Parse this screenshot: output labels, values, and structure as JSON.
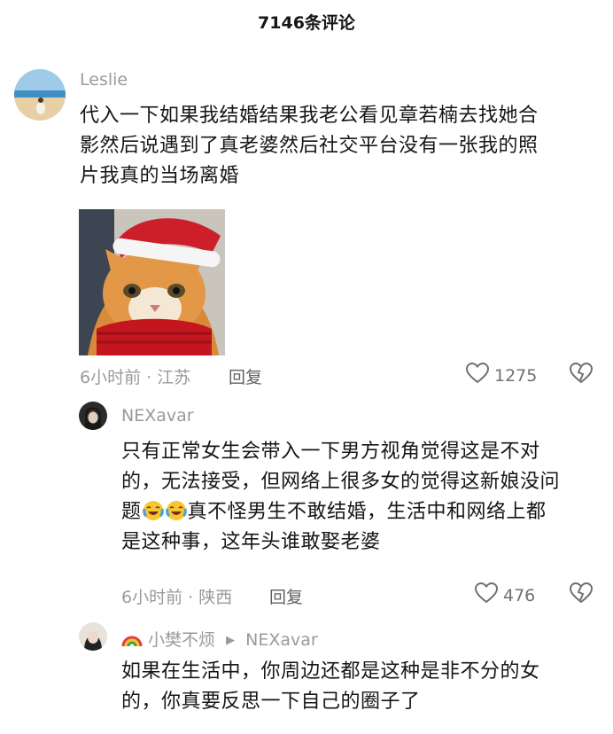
{
  "header": {
    "title": "7146条评论"
  },
  "comments": [
    {
      "username": "Leslie",
      "lines": [
        "代入一下如果我结婚结果我老公看见章若楠去找她合",
        "影然后说遇到了真老婆然后社交平台没有一张我的照",
        "片我真的当场离婚"
      ],
      "image_icon": "cat-santa-hat-image",
      "meta": "6小时前 · 江苏",
      "reply_label": "回复",
      "likes": "1275"
    },
    {
      "username": "NEXavar",
      "lines": [
        "只有正常女生会带入一下男方视角觉得这是不对",
        "的，无法接受，但网络上很多女的觉得这新娘没问",
        "真不怪男生不敢结婚，生活中和网络上都",
        "是这种事，这年头谁敢娶老婆"
      ],
      "line3_prefix": "题",
      "meta": "6小时前 · 陕西",
      "reply_label": "回复",
      "likes": "476"
    },
    {
      "username": "小樊不烦",
      "reply_to": "NEXavar",
      "lines": [
        "如果在生活中，你周边还都是这种是非不分的女",
        "的，你真要反思一下自己的圈子了"
      ]
    }
  ],
  "colors": {
    "text": "#161616",
    "meta": "#9a9a9a",
    "background": "#ffffff"
  }
}
